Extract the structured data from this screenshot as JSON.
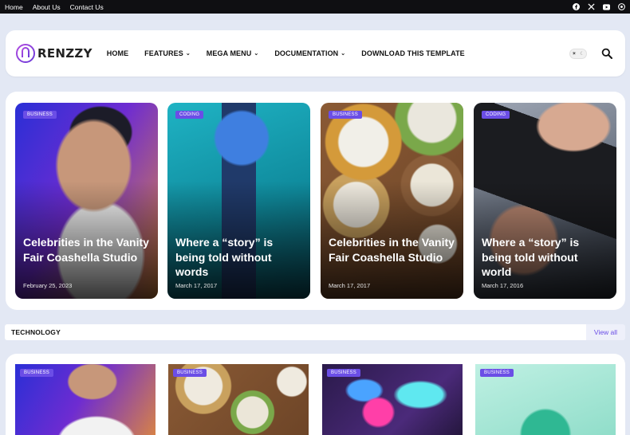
{
  "topbar": {
    "links": [
      "Home",
      "About Us",
      "Contact Us"
    ],
    "social_icons": [
      "facebook-icon",
      "x-icon",
      "youtube-icon",
      "telegram-icon"
    ]
  },
  "header": {
    "logo_text": "RENZZY",
    "nav": [
      {
        "label": "HOME",
        "dropdown": false
      },
      {
        "label": "FEATURES",
        "dropdown": true
      },
      {
        "label": "MEGA MENU",
        "dropdown": true
      },
      {
        "label": "DOCUMENTATION",
        "dropdown": true
      },
      {
        "label": "DOWNLOAD THIS TEMPLATE",
        "dropdown": false
      }
    ],
    "theme_toggle_icons": [
      "sun-icon",
      "moon-icon"
    ],
    "search_icon": "search-icon"
  },
  "featured": [
    {
      "tag": "BUSINESS",
      "title": "Celebrities in the Vanity Fair Coashella Studio",
      "date": "February 25, 2023"
    },
    {
      "tag": "CODING",
      "title": "Where a “story” is being told without words",
      "date": "March 17, 2017"
    },
    {
      "tag": "BUSINESS",
      "title": "Celebrities in the Vanity Fair Coashella Studio",
      "date": "March 17, 2017"
    },
    {
      "tag": "CODING",
      "title": "Where a “story” is being told without world",
      "date": "March 17, 2016"
    }
  ],
  "section": {
    "title": "TECHNOLOGY",
    "view_all": "View all"
  },
  "grid": [
    {
      "tag": "BUSINESS"
    },
    {
      "tag": "BUSINESS"
    },
    {
      "tag": "BUSINESS"
    },
    {
      "tag": "BUSINESS"
    }
  ],
  "colors": {
    "accent": "#6b4ee6",
    "topbar": "#0f0f12",
    "page_bg": "#e3e8f4"
  }
}
